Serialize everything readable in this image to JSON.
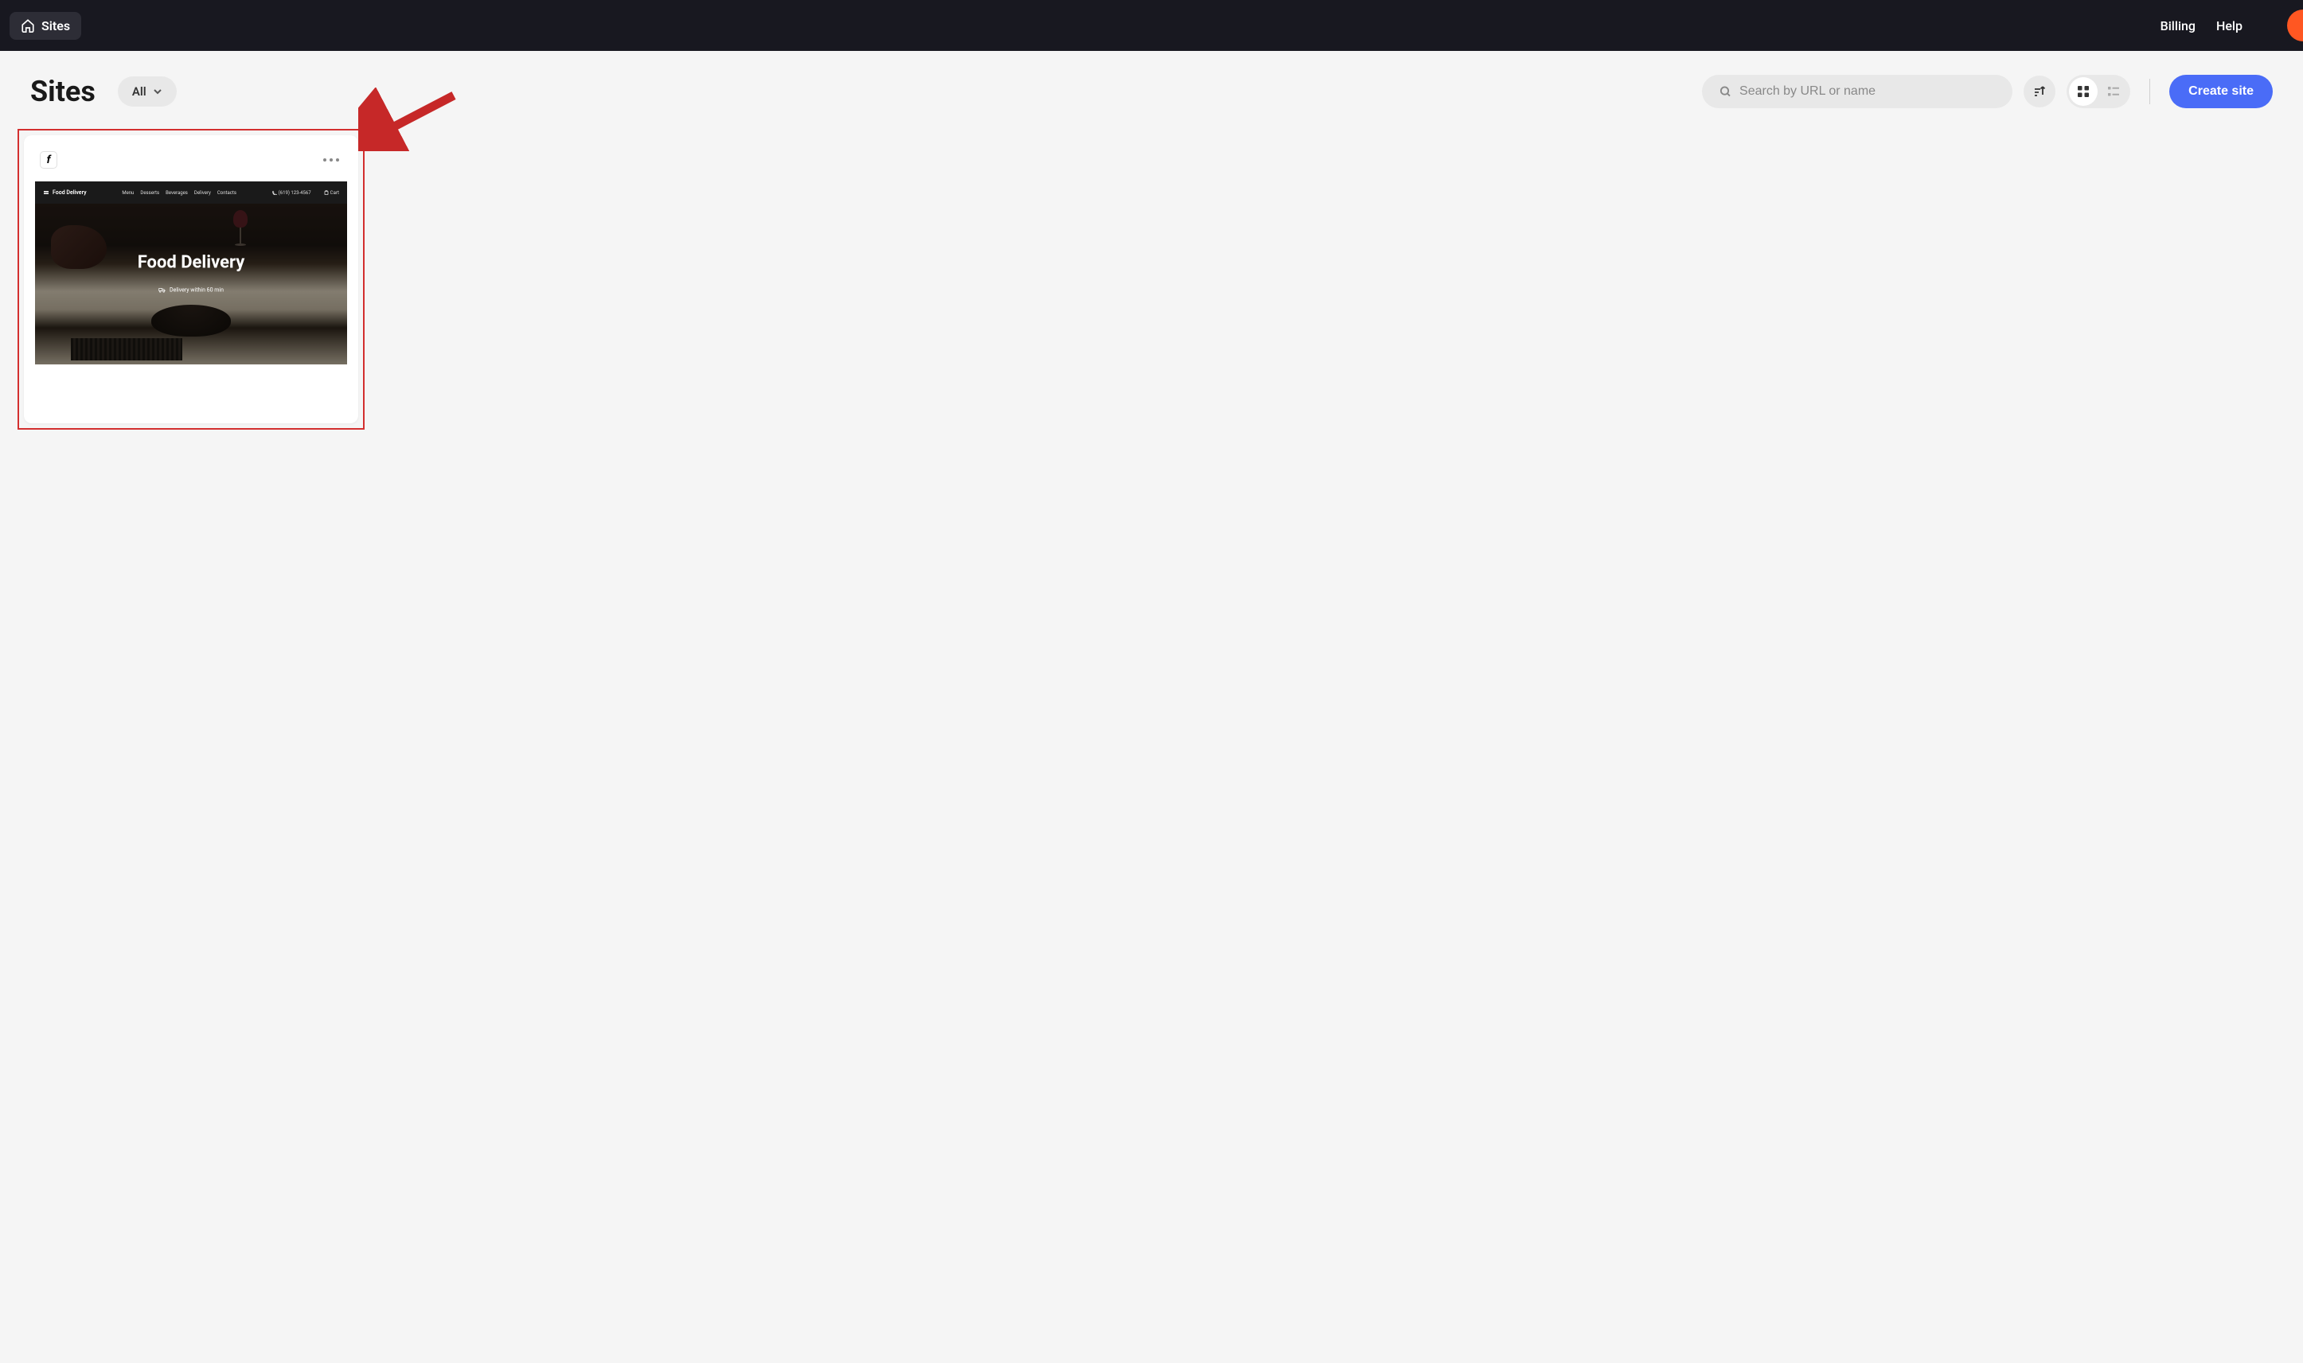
{
  "header": {
    "title": "Sites",
    "links": {
      "billing": "Billing",
      "help": "Help"
    }
  },
  "toolbar": {
    "page_title": "Sites",
    "filter_label": "All",
    "search_placeholder": "Search by URL or name",
    "create_label": "Create site"
  },
  "site_card": {
    "preview": {
      "logo_text": "Food Delivery",
      "nav_items": [
        "Menu",
        "Desserts",
        "Beverages",
        "Delivery",
        "Contacts"
      ],
      "phone": "(619) 123-4567",
      "cart_label": "Cart",
      "hero_title": "Food Delivery",
      "hero_subtitle": "Delivery within 60 min"
    }
  }
}
